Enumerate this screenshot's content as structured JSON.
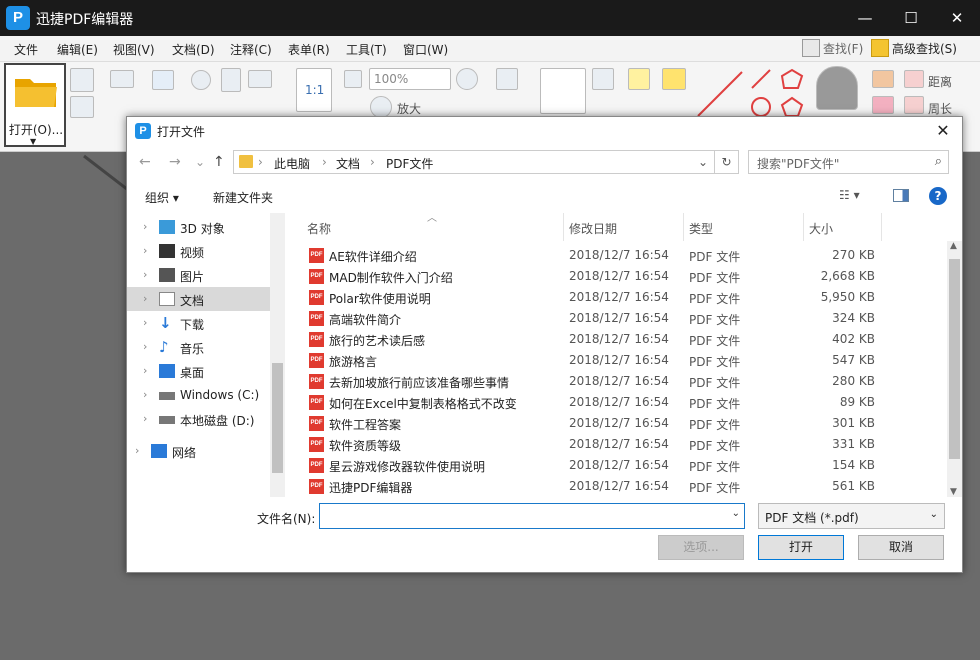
{
  "app": {
    "title": "迅捷PDF编辑器",
    "logo": "P",
    "min": "—",
    "max": "☐",
    "close": "✕"
  },
  "menu": {
    "items": [
      "文件",
      "编辑(E)",
      "视图(V)",
      "文档(D)",
      "注释(C)",
      "表单(R)",
      "工具(T)",
      "窗口(W)"
    ],
    "find": "查找(F)",
    "adv_find": "高级查找(S)"
  },
  "toolbar": {
    "open": "打开(O)...",
    "zoom": "100%",
    "zoom_in_label": "放大",
    "distance": "距离",
    "perimeter": "周长"
  },
  "dialog": {
    "title": "打开文件",
    "close": "✕",
    "nav": {
      "back": "←",
      "forward": "→",
      "recent": "⌄",
      "up": "↑"
    },
    "breadcrumb": [
      "此电脑",
      "文档",
      "PDF文件"
    ],
    "refresh": "↻",
    "search_placeholder": "搜索\"PDF文件\"",
    "organize": "组织 ▾",
    "new_folder": "新建文件夹",
    "tree": [
      {
        "label": "3D 对象",
        "icon": "3d-objects-icon",
        "color": "#3a9ad9"
      },
      {
        "label": "视频",
        "icon": "video-icon",
        "color": "#333"
      },
      {
        "label": "图片",
        "icon": "pictures-icon",
        "color": "#555"
      },
      {
        "label": "文档",
        "icon": "documents-icon",
        "color": "#888",
        "selected": true
      },
      {
        "label": "下载",
        "icon": "downloads-icon",
        "color": "#2a7ad8"
      },
      {
        "label": "音乐",
        "icon": "music-icon",
        "color": "#2a7ad8"
      },
      {
        "label": "桌面",
        "icon": "desktop-icon",
        "color": "#2a7ad8"
      },
      {
        "label": "Windows (C:)",
        "icon": "drive-c-icon",
        "color": "#555"
      },
      {
        "label": "本地磁盘 (D:)",
        "icon": "drive-d-icon",
        "color": "#555"
      },
      {
        "label": "网络",
        "icon": "network-icon",
        "color": "#2a7ad8"
      }
    ],
    "columns": {
      "name": "名称",
      "date": "修改日期",
      "type": "类型",
      "size": "大小"
    },
    "files": [
      {
        "name": "AE软件详细介绍",
        "date": "2018/12/7 16:54",
        "type": "PDF 文件",
        "size": "270 KB"
      },
      {
        "name": "MAD制作软件入门介绍",
        "date": "2018/12/7 16:54",
        "type": "PDF 文件",
        "size": "2,668 KB"
      },
      {
        "name": "Polar软件使用说明",
        "date": "2018/12/7 16:54",
        "type": "PDF 文件",
        "size": "5,950 KB"
      },
      {
        "name": "高端软件简介",
        "date": "2018/12/7 16:54",
        "type": "PDF 文件",
        "size": "324 KB"
      },
      {
        "name": "旅行的艺术读后感",
        "date": "2018/12/7 16:54",
        "type": "PDF 文件",
        "size": "402 KB"
      },
      {
        "name": "旅游格言",
        "date": "2018/12/7 16:54",
        "type": "PDF 文件",
        "size": "547 KB"
      },
      {
        "name": "去新加坡旅行前应该准备哪些事情",
        "date": "2018/12/7 16:54",
        "type": "PDF 文件",
        "size": "280 KB"
      },
      {
        "name": "如何在Excel中复制表格格式不改变",
        "date": "2018/12/7 16:54",
        "type": "PDF 文件",
        "size": "89 KB"
      },
      {
        "name": "软件工程答案",
        "date": "2018/12/7 16:54",
        "type": "PDF 文件",
        "size": "301 KB"
      },
      {
        "name": "软件资质等级",
        "date": "2018/12/7 16:54",
        "type": "PDF 文件",
        "size": "331 KB"
      },
      {
        "name": "星云游戏修改器软件使用说明",
        "date": "2018/12/7 16:54",
        "type": "PDF 文件",
        "size": "154 KB"
      },
      {
        "name": "迅捷PDF编辑器",
        "date": "2018/12/7 16:54",
        "type": "PDF 文件",
        "size": "561 KB"
      }
    ],
    "pdf_icon_text": "PDF",
    "filename_label": "文件名(N):",
    "filename_value": "",
    "filetype": "PDF 文档 (*.pdf)",
    "btn_options": "选项...",
    "btn_open": "打开",
    "btn_cancel": "取消"
  }
}
